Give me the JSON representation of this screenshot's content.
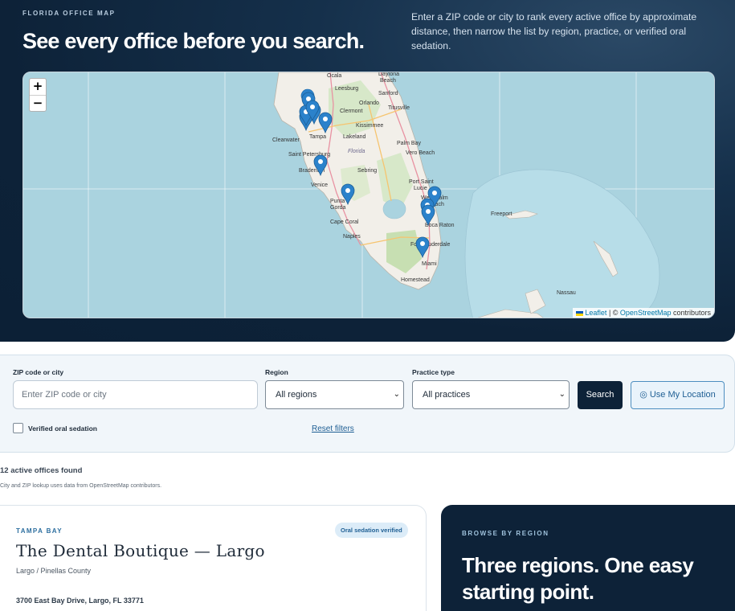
{
  "hero": {
    "eyebrow": "FLORIDA OFFICE MAP",
    "title": "See every office before you search.",
    "description": "Enter a ZIP code or city to rank every active office by approximate distance, then narrow the list by region, practice, or verified oral sedation."
  },
  "map": {
    "zoom_in": "+",
    "zoom_out": "−",
    "attribution_leaflet": "Leaflet",
    "attribution_sep": " | © ",
    "attribution_osm": "OpenStreetMap",
    "attribution_tail": " contributors",
    "places": [
      "Ocala",
      "Daytona Beach",
      "Leesburg",
      "Sanford",
      "Orlando",
      "Titusville",
      "Clermont",
      "Kissimmee",
      "Clearwater",
      "Tampa",
      "Lakeland",
      "Saint Petersburg",
      "Florida",
      "Palm Bay",
      "Vero Beach",
      "Bradenton",
      "Sebring",
      "Venice",
      "Port Saint Lucie",
      "Punta Gorda",
      "West Palm Beach",
      "Cape Coral",
      "Boca Raton",
      "Naples",
      "Fort Lauderdale",
      "Miami",
      "Homestead",
      "Freeport",
      "Nassau"
    ],
    "marker_count": 12,
    "marker_color": "#2b82cb"
  },
  "filters": {
    "zip_label": "ZIP code or city",
    "zip_placeholder": "Enter ZIP code or city",
    "zip_value": "",
    "region_label": "Region",
    "region_value": "All regions",
    "practice_label": "Practice type",
    "practice_value": "All practices",
    "search_button": "Search",
    "location_button": "◎ Use My Location",
    "sedation_label": "Verified oral sedation",
    "sedation_checked": false,
    "reset": "Reset filters"
  },
  "results": {
    "count": "12 active offices found",
    "note": "City and ZIP lookup uses data from OpenStreetMap contributors."
  },
  "office_card": {
    "region": "TAMPA BAY",
    "badge": "Oral sedation verified",
    "name": "The Dental Boutique — Largo",
    "city": "Largo / Pinellas County",
    "address": "3700 East Bay Drive, Largo, FL 33771"
  },
  "region_card": {
    "eyebrow": "BROWSE BY REGION",
    "title": "Three regions. One easy starting point."
  },
  "colors": {
    "navy": "#0d2238",
    "accent": "#1f5f94",
    "water": "#aad3df",
    "land": "#f2efe9"
  }
}
